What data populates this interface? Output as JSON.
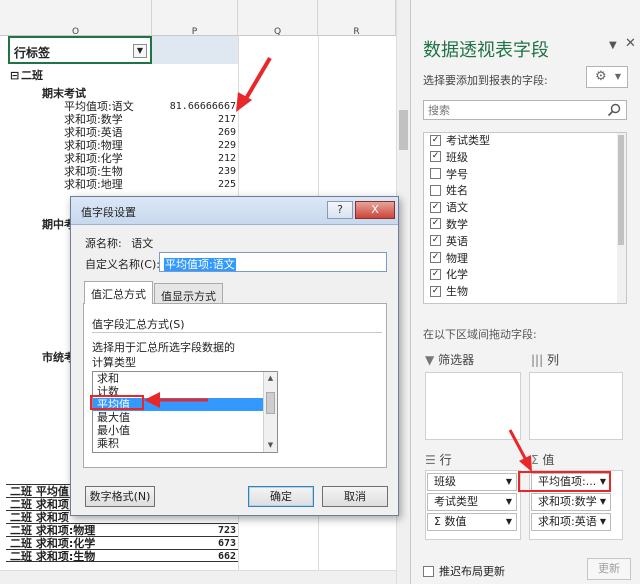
{
  "sheet": {
    "columns": [
      "O",
      "P",
      "Q",
      "R"
    ],
    "row_label_header": "行标签",
    "group_class": "二班",
    "sections": [
      {
        "title": "期末考试",
        "rows": [
          {
            "label": "平均值项:语文",
            "value": "81.66666667"
          },
          {
            "label": "求和项:数学",
            "value": "217"
          },
          {
            "label": "求和项:英语",
            "value": "269"
          },
          {
            "label": "求和项:物理",
            "value": "229"
          },
          {
            "label": "求和项:化学",
            "value": "212"
          },
          {
            "label": "求和项:生物",
            "value": "239"
          },
          {
            "label": "求和项:地理",
            "value": "225"
          }
        ]
      },
      {
        "title": "期中考"
      },
      {
        "title": "市统考"
      }
    ],
    "bottom_rows": [
      {
        "label": "二班  平均值",
        "value": ""
      },
      {
        "label": "二班  求和项",
        "value": ""
      },
      {
        "label": "二班  求和项",
        "value": ""
      },
      {
        "label": "二班  求和项:物理",
        "value": "723"
      },
      {
        "label": "二班  求和项:化学",
        "value": "673"
      },
      {
        "label": "二班  求和项:生物",
        "value": "662"
      }
    ]
  },
  "dialog": {
    "title": "值字段设置",
    "source_label": "源名称:",
    "source_value": "语文",
    "custom_name_label": "自定义名称(C):",
    "custom_name_value": "平均值项:语文",
    "tabs": [
      "值汇总方式",
      "值显示方式"
    ],
    "group_title": "值字段汇总方式(S)",
    "description_line1": "选择用于汇总所选字段数据的",
    "description_line2": "计算类型",
    "functions": [
      "求和",
      "计数",
      "平均值",
      "最大值",
      "最小值",
      "乘积"
    ],
    "selected_function": "平均值",
    "number_format_button": "数字格式(N)",
    "ok_button": "确定",
    "cancel_button": "取消",
    "help_button": "?",
    "close_button": "X"
  },
  "pane": {
    "title": "数据透视表字段",
    "choose_label": "选择要添加到报表的字段:",
    "search_placeholder": "搜索",
    "fields": [
      {
        "name": "考试类型",
        "checked": true
      },
      {
        "name": "班级",
        "checked": true
      },
      {
        "name": "学号",
        "checked": false
      },
      {
        "name": "姓名",
        "checked": false
      },
      {
        "name": "语文",
        "checked": true
      },
      {
        "name": "数学",
        "checked": true
      },
      {
        "name": "英语",
        "checked": true
      },
      {
        "name": "物理",
        "checked": true
      },
      {
        "name": "化学",
        "checked": true
      },
      {
        "name": "生物",
        "checked": true
      }
    ],
    "drag_label": "在以下区域间拖动字段:",
    "areas": {
      "filters": "筛选器",
      "columns": "列",
      "rows": "行",
      "values": "值"
    },
    "row_chips": [
      "班级",
      "考试类型",
      "Σ 数值"
    ],
    "value_chips": [
      "平均值项:...",
      "求和项:数学",
      "求和项:英语"
    ],
    "defer_label": "推迟布局更新",
    "update_button": "更新"
  },
  "colors": {
    "accent_green": "#217346",
    "highlight_red": "#e8272b",
    "selection_blue": "#3399ff"
  }
}
